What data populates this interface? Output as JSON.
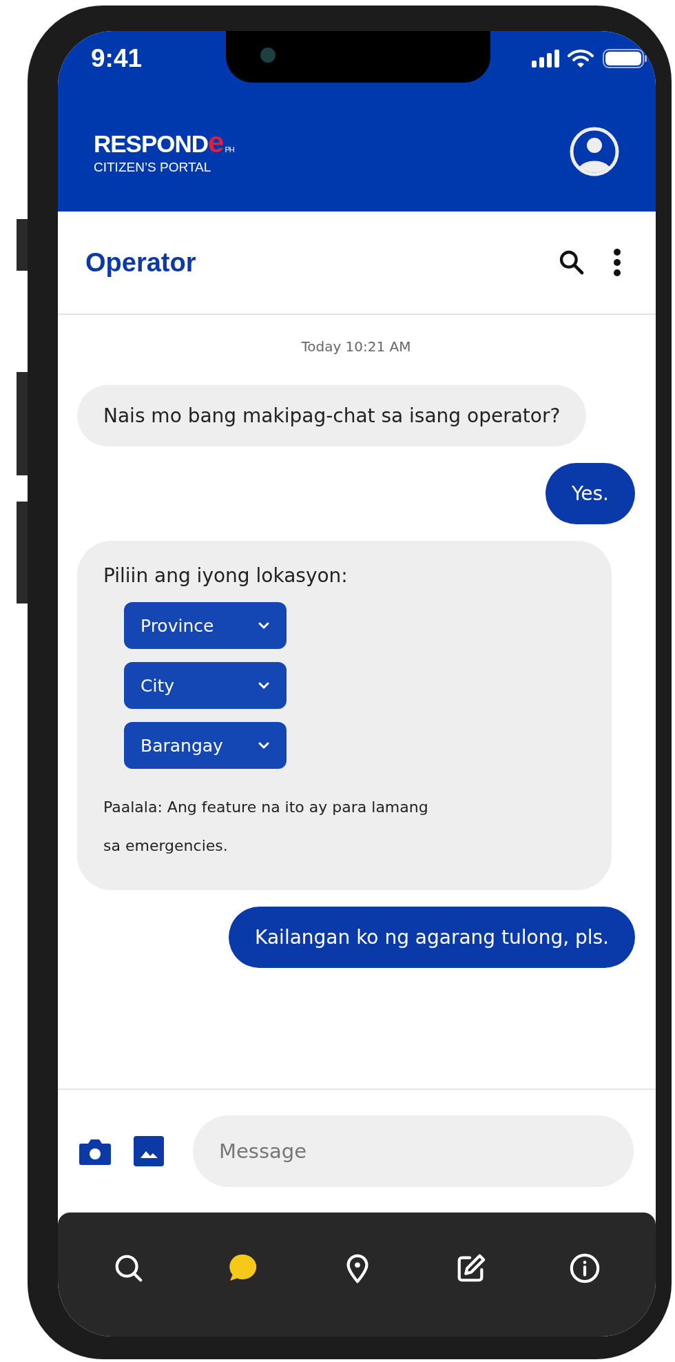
{
  "status_bar": {
    "time": "9:41"
  },
  "app_bar": {
    "logo": {
      "wordmark": "RESPOND",
      "accent": "e",
      "suffix": "PH",
      "subtitle": "CITIZEN’S PORTAL"
    }
  },
  "chat_header": {
    "title": "Operator"
  },
  "timestamp": "Today 10:21 AM",
  "messages": [
    {
      "kind": "received",
      "text": "Nais mo bang makipag-chat sa isang operator?"
    },
    {
      "kind": "sent",
      "text": "Yes."
    },
    {
      "kind": "location_form",
      "prompt": "Piliin ang iyong lokasyon:",
      "dropdowns": [
        "Province",
        "City",
        "Barangay"
      ],
      "note": "Paalala: Ang feature na ito ay para lamang sa emergencies."
    },
    {
      "kind": "sent",
      "text": "Kailangan ko ng agarang tulong, pls."
    }
  ],
  "composer": {
    "placeholder": "Message"
  },
  "bottom_nav": [
    {
      "kind": "search",
      "selected": false
    },
    {
      "kind": "chat",
      "selected": true
    },
    {
      "kind": "location",
      "selected": false
    },
    {
      "kind": "edit",
      "selected": false
    },
    {
      "kind": "info",
      "selected": false
    }
  ]
}
